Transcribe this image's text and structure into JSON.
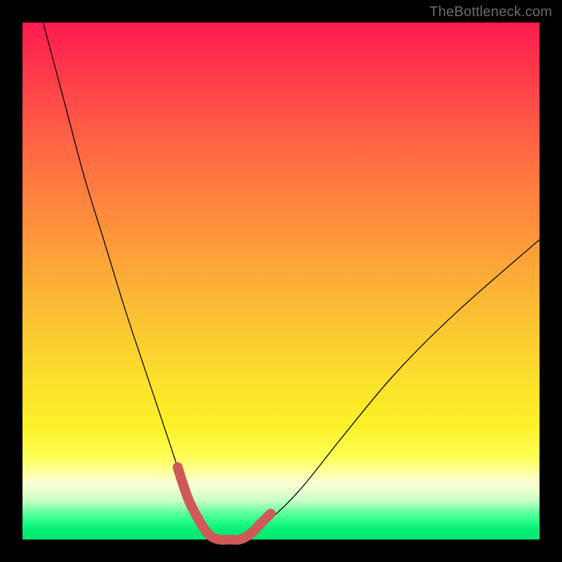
{
  "watermark": "TheBottleneck.com",
  "colors": {
    "frame": "#000000",
    "curve_thin": "#000000",
    "curve_thick": "#cf5858"
  },
  "chart_data": {
    "type": "line",
    "title": "",
    "xlabel": "",
    "ylabel": "",
    "xlim": [
      0,
      100
    ],
    "ylim": [
      0,
      100
    ],
    "grid": false,
    "legend": false,
    "background_gradient": [
      {
        "stop": 0,
        "color": "#ff1a4f"
      },
      {
        "stop": 35,
        "color": "#fe853e"
      },
      {
        "stop": 70,
        "color": "#fbe22b"
      },
      {
        "stop": 89,
        "color": "#feffd3"
      },
      {
        "stop": 95,
        "color": "#59ff9a"
      },
      {
        "stop": 100,
        "color": "#05e873"
      }
    ],
    "series": [
      {
        "name": "bottleneck-curve",
        "x": [
          4,
          8,
          12,
          16,
          20,
          24,
          28,
          30,
          32,
          34,
          36,
          38,
          40,
          42,
          44,
          48,
          54,
          62,
          72,
          84,
          100
        ],
        "y": [
          100,
          85,
          70,
          57,
          44,
          32,
          20,
          14,
          8,
          4,
          1,
          0,
          0,
          0,
          1,
          4,
          10,
          20,
          32,
          44,
          58
        ]
      }
    ],
    "highlight_segment": {
      "name": "optimal-range",
      "x": [
        30,
        32,
        34,
        36,
        38,
        40,
        42,
        44,
        46,
        48
      ],
      "y": [
        14,
        8,
        4,
        1,
        0,
        0,
        0,
        1,
        3,
        5
      ]
    }
  }
}
